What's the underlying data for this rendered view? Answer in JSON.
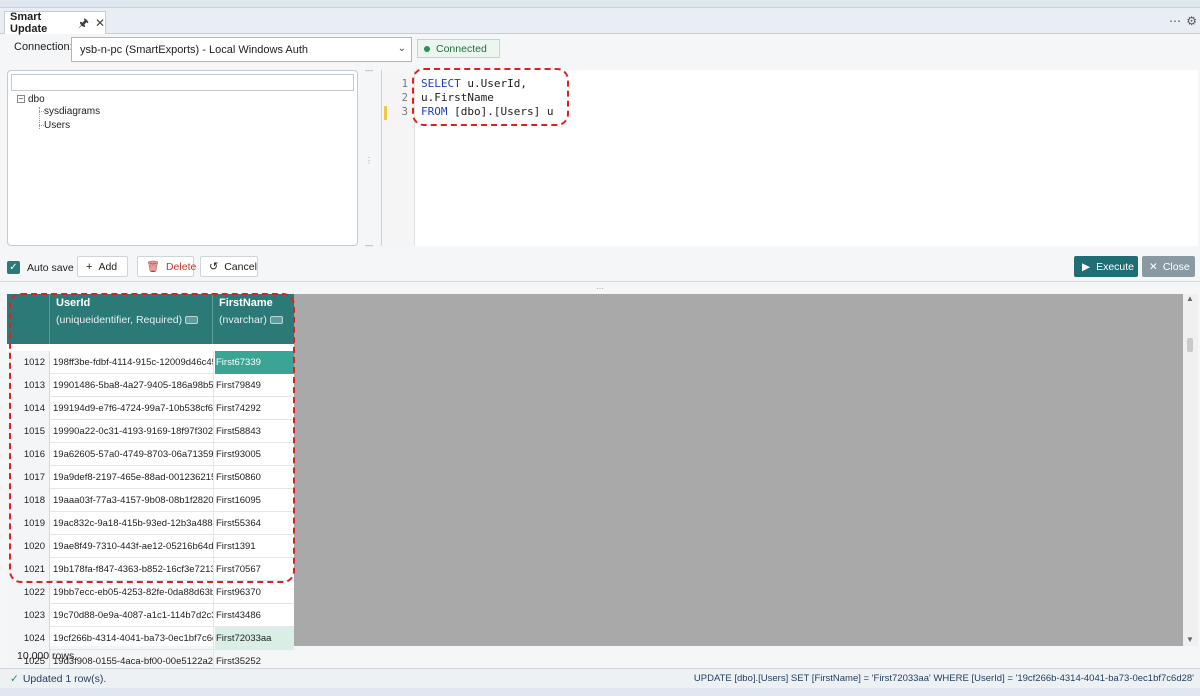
{
  "tab": {
    "title": "Smart Update"
  },
  "connection": {
    "label": "Connection:",
    "value": "ysb-n-pc (SmartExports) - Local Windows Auth",
    "status": "Connected"
  },
  "tree": {
    "root": "dbo",
    "children": [
      "sysdiagrams",
      "Users"
    ]
  },
  "editor": {
    "line_numbers": [
      "1",
      "2",
      "3"
    ],
    "lines": [
      {
        "kw": "SELECT",
        "rest": " u.UserId,"
      },
      {
        "kw": "",
        "rest": "u.FirstName"
      },
      {
        "kw": "FROM",
        "rest": " [dbo].[Users] u"
      }
    ]
  },
  "toolbar": {
    "autosave_label": "Auto save",
    "add_label": "Add",
    "delete_label": "Delete",
    "cancel_label": "Cancel",
    "execute_label": "Execute",
    "close_label": "Close"
  },
  "grid": {
    "columns": [
      {
        "name": "UserId",
        "type": "(uniqueidentifier, Required)"
      },
      {
        "name": "FirstName",
        "type": "(nvarchar)"
      }
    ],
    "rows": [
      {
        "n": "1012",
        "id": "198ff3be-fdbf-4114-915c-12009d46c453",
        "first": "First67339"
      },
      {
        "n": "1013",
        "id": "19901486-5ba8-4a27-9405-186a98b5b...",
        "first": "First79849"
      },
      {
        "n": "1014",
        "id": "199194d9-e7f6-4724-99a7-10b538cf6e0f",
        "first": "First74292"
      },
      {
        "n": "1015",
        "id": "19990a22-0c31-4193-9169-18f97f30297e",
        "first": "First58843"
      },
      {
        "n": "1016",
        "id": "19a62605-57a0-4749-8703-06a7135938...",
        "first": "First93005"
      },
      {
        "n": "1017",
        "id": "19a9def8-2197-465e-88ad-0012362154...",
        "first": "First50860"
      },
      {
        "n": "1018",
        "id": "19aaa03f-77a3-4157-9b08-08b1f28200...",
        "first": "First16095"
      },
      {
        "n": "1019",
        "id": "19ac832c-9a18-415b-93ed-12b3a4884...",
        "first": "First55364"
      },
      {
        "n": "1020",
        "id": "19ae8f49-7310-443f-ae12-05216b64de...",
        "first": "First1391"
      },
      {
        "n": "1021",
        "id": "19b178fa-f847-4363-b852-16cf3e721351",
        "first": "First70567"
      },
      {
        "n": "1022",
        "id": "19bb7ecc-eb05-4253-82fe-0da88d63b...",
        "first": "First96370"
      },
      {
        "n": "1023",
        "id": "19c70d88-0e9a-4087-a1c1-114b7d2c3...",
        "first": "First43486"
      },
      {
        "n": "1024",
        "id": "19cf266b-4314-4041-ba73-0ec1bf7c6d...",
        "first": "First72033aa"
      },
      {
        "n": "1025",
        "id": "19d3f908-0155-4aca-bf00-00e5122a28...",
        "first": "First35252"
      }
    ],
    "row_count": "10,000 rows"
  },
  "status": {
    "message": "Updated 1 row(s).",
    "sql": "UPDATE [dbo].[Users] SET [FirstName] = 'First72033aa' WHERE [UserId] = '19cf266b-4314-4041-ba73-0ec1bf7c6d28'"
  },
  "colors": {
    "accent": "#2b7a78",
    "selected_cell": "#3aa495",
    "highlight_cell": "#d9efe6",
    "outline": "#e02020"
  }
}
